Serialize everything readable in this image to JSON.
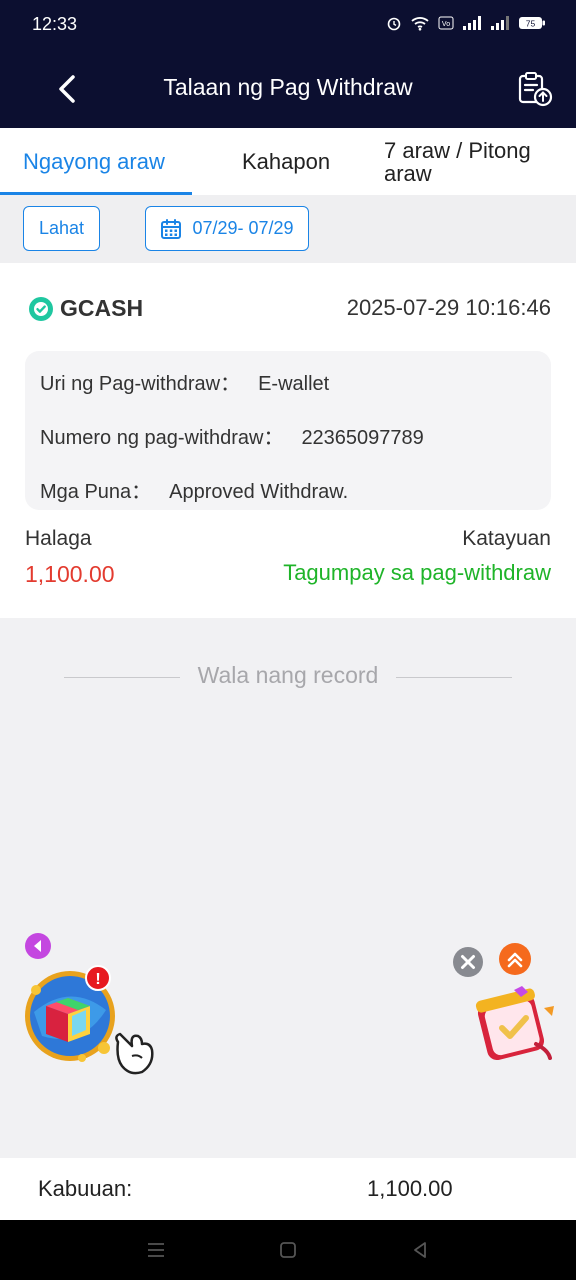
{
  "status_bar": {
    "time": "12:33",
    "battery": "75"
  },
  "header": {
    "title": "Talaan ng Pag Withdraw"
  },
  "tabs": [
    {
      "label": "Ngayong araw",
      "active": true
    },
    {
      "label": "Kahapon",
      "active": false
    },
    {
      "label": "7 araw / Pitong araw",
      "active": false
    }
  ],
  "filters": {
    "all_label": "Lahat",
    "date_range": "07/29- 07/29"
  },
  "record": {
    "brand": "GCASH",
    "datetime": "2025-07-29 10:16:46",
    "details": [
      {
        "key": "Uri ng Pag-withdraw：",
        "value": "E-wallet"
      },
      {
        "key": "Numero ng pag-withdraw：",
        "value": "22365097789"
      },
      {
        "key": "Mga Puna：",
        "value": "Approved Withdraw."
      }
    ],
    "amount_label": "Halaga",
    "amount": "1,100.00",
    "status_label": "Katayuan",
    "status": "Tagumpay sa pag-withdraw"
  },
  "empty_text": "Wala nang record",
  "footer": {
    "total_label": "Kabuuan:",
    "total_value": "1,100.00"
  },
  "colors": {
    "header_bg": "#0c0f30",
    "accent": "#1a84e6",
    "amount": "#e33b2f",
    "success": "#1fb429"
  },
  "icons": [
    "back-arrow-icon",
    "record-upload-icon",
    "calendar-icon",
    "gcash-logo-icon",
    "close-icon",
    "scroll-top-icon"
  ]
}
